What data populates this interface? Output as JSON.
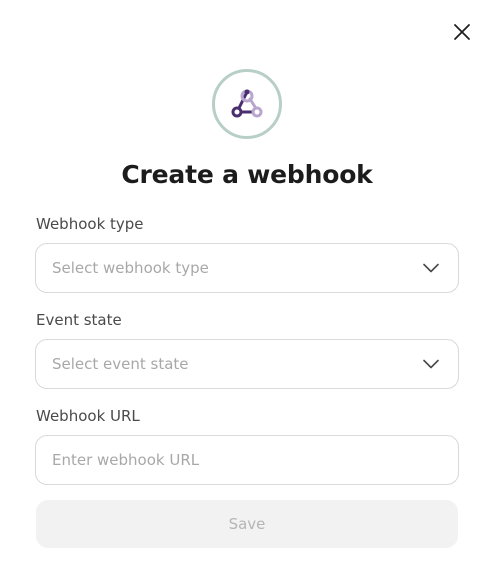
{
  "dialog": {
    "title": "Create a webhook",
    "close_icon": "close-icon",
    "logo_icon": "webhook-icon"
  },
  "fields": {
    "webhook_type": {
      "label": "Webhook type",
      "placeholder": "Select webhook type",
      "icon": "chevron-down-icon"
    },
    "event_state": {
      "label": "Event state",
      "placeholder": "Select event state",
      "icon": "chevron-down-icon"
    },
    "webhook_url": {
      "label": "Webhook URL",
      "placeholder": "Enter webhook URL",
      "value": ""
    }
  },
  "actions": {
    "save_label": "Save"
  },
  "colors": {
    "logo_ring": "#b7cfc6",
    "logo_primary": "#4a2f6e",
    "logo_secondary": "#b9a6cf",
    "save_bg": "#f2f2f2",
    "save_text": "#b5b5b5"
  }
}
